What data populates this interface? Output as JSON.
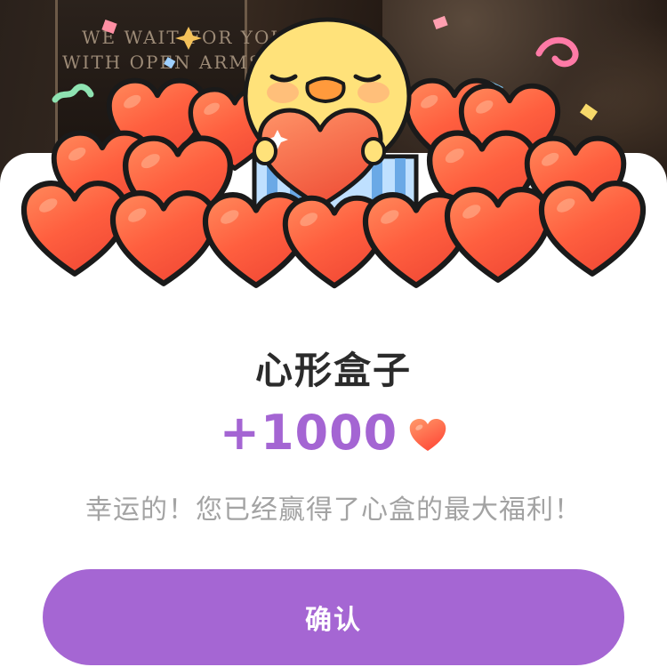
{
  "background": {
    "caption_line1": "WE WAIT FOR YOU",
    "caption_line2": "WITH OPEN ARMS"
  },
  "reward": {
    "title": "心形盒子",
    "amount": "+1000",
    "currency_icon": "heart-icon",
    "message": "幸运的！您已经赢得了心盒的最大福利！"
  },
  "actions": {
    "confirm_label": "确认"
  },
  "colors": {
    "accent": "#a566d3",
    "amount_text": "#a465d3",
    "heart": "#ff5a3c",
    "chick": "#ffe27a"
  }
}
